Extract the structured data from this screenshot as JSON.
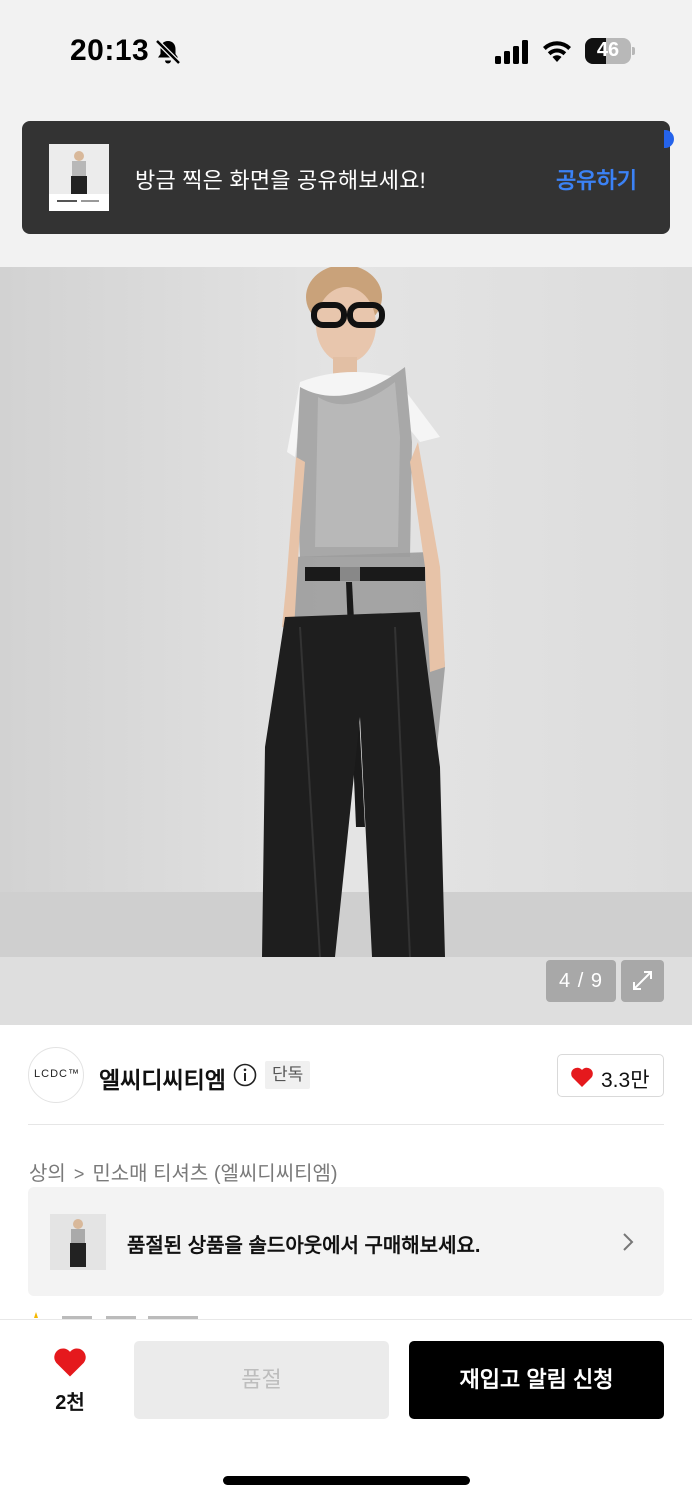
{
  "status_bar": {
    "time": "20:13",
    "battery_level": "46",
    "icons": [
      "bell-slash-icon",
      "cellular-signal-icon",
      "wifi-icon",
      "battery-icon"
    ]
  },
  "toast": {
    "message": "방금 찍은 화면을 공유해보세요!",
    "action_label": "공유하기",
    "action_color": "#3b82f6",
    "thumbnail_icon": "screenshot-thumbnail"
  },
  "gallery": {
    "counter": "4 / 9",
    "expand_icon": "expand-arrows-icon"
  },
  "brand": {
    "logo_text": "LCDC™",
    "name": "엘씨디씨티엠",
    "badge": "단독",
    "like_count": "3.3만"
  },
  "breadcrumb": {
    "category": "상의",
    "subcategory": "민소매 티셔츠 (엘씨디씨티엠)"
  },
  "soldout_banner": {
    "text": "품절된 상품을 솔드아웃에서 구매해보세요."
  },
  "bottom_bar": {
    "wish_count": "2천",
    "soldout_label": "품절",
    "restock_label": "재입고 알림 신청",
    "heart_color": "#e5191d"
  }
}
